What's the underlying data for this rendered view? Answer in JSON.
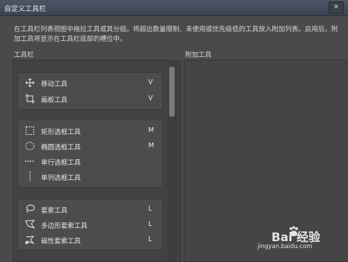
{
  "dialog": {
    "title": "自定义工具栏"
  },
  "description": "在工具栏列表视图中拖拉工具或其分组。将超出数量限制、未使用或优先级低的工具放入附加列表。启用后，附加工具将显示在工具栏底部的槽位中。",
  "labels": {
    "toolbar": "工具栏",
    "extra_tools": "附加工具"
  },
  "groups": [
    {
      "items": [
        {
          "label": "移动工具",
          "key": "V",
          "icon": "move-icon"
        },
        {
          "label": "画板工具",
          "key": "V",
          "icon": "artboard-icon"
        }
      ]
    },
    {
      "items": [
        {
          "label": "矩形选框工具",
          "key": "M",
          "icon": "rect-marquee-icon"
        },
        {
          "label": "椭圆选框工具",
          "key": "M",
          "icon": "ellipse-marquee-icon"
        },
        {
          "label": "单行选框工具",
          "key": "",
          "icon": "single-row-marquee-icon"
        },
        {
          "label": "单列选框工具",
          "key": "",
          "icon": "single-column-marquee-icon"
        }
      ]
    },
    {
      "items": [
        {
          "label": "套索工具",
          "key": "L",
          "icon": "lasso-icon"
        },
        {
          "label": "多边形套索工具",
          "key": "L",
          "icon": "polygonal-lasso-icon"
        },
        {
          "label": "磁性套索工具",
          "key": "L",
          "icon": "magnetic-lasso-icon"
        }
      ]
    }
  ],
  "watermark": {
    "brand": "Bai 经验",
    "url": "jingyan.baidu.com"
  }
}
